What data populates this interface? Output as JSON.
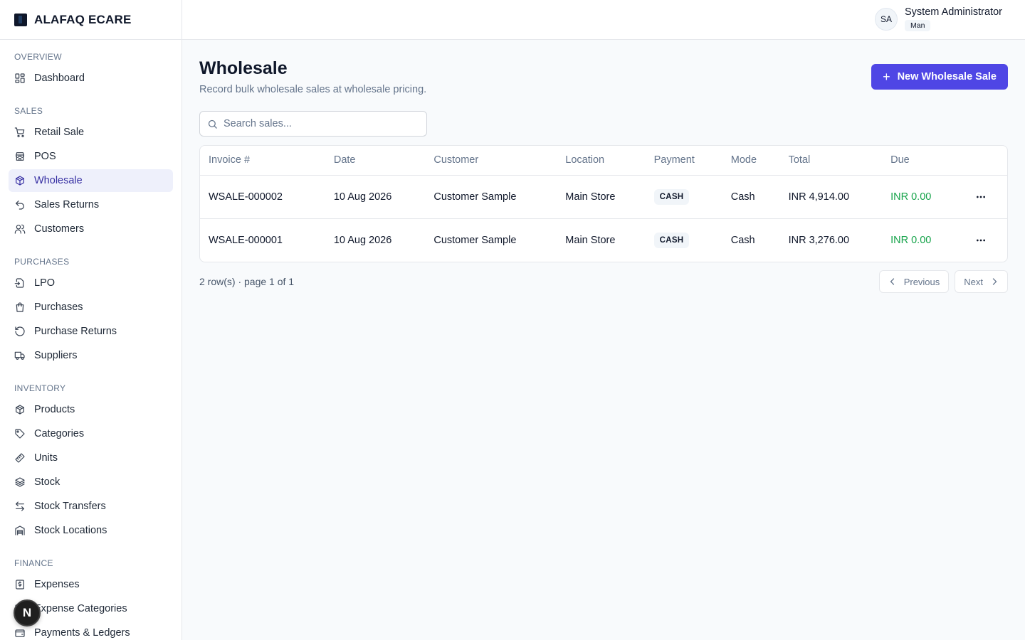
{
  "brand": {
    "name": "ALAFAQ ECARE"
  },
  "user": {
    "initials": "SA",
    "name": "System Administrator",
    "role": "Man"
  },
  "sidebar": {
    "sections": [
      {
        "title": "OVERVIEW",
        "items": [
          {
            "label": "Dashboard",
            "icon": "dashboard-icon"
          }
        ]
      },
      {
        "title": "SALES",
        "items": [
          {
            "label": "Retail Sale",
            "icon": "cart-icon"
          },
          {
            "label": "POS",
            "icon": "store-icon"
          },
          {
            "label": "Wholesale",
            "icon": "boxes-icon",
            "active": true
          },
          {
            "label": "Sales Returns",
            "icon": "undo-icon"
          },
          {
            "label": "Customers",
            "icon": "users-icon"
          }
        ]
      },
      {
        "title": "PURCHASES",
        "items": [
          {
            "label": "LPO",
            "icon": "file-import-icon"
          },
          {
            "label": "Purchases",
            "icon": "shopping-bag-icon"
          },
          {
            "label": "Purchase Returns",
            "icon": "rotate-icon"
          },
          {
            "label": "Suppliers",
            "icon": "truck-icon"
          }
        ]
      },
      {
        "title": "INVENTORY",
        "items": [
          {
            "label": "Products",
            "icon": "package-icon"
          },
          {
            "label": "Categories",
            "icon": "tag-icon"
          },
          {
            "label": "Units",
            "icon": "ruler-icon"
          },
          {
            "label": "Stock",
            "icon": "layers-icon"
          },
          {
            "label": "Stock Transfers",
            "icon": "arrows-transfer-icon"
          },
          {
            "label": "Stock Locations",
            "icon": "warehouse-icon"
          }
        ]
      },
      {
        "title": "FINANCE",
        "items": [
          {
            "label": "Expenses",
            "icon": "receipt-icon"
          },
          {
            "label": "Expense Categories",
            "icon": "list-icon"
          },
          {
            "label": "Payments & Ledgers",
            "icon": "wallet-icon"
          }
        ]
      }
    ]
  },
  "page": {
    "title": "Wholesale",
    "subtitle": "Record bulk wholesale sales at wholesale pricing.",
    "new_button": "New Wholesale Sale",
    "search_placeholder": "Search sales..."
  },
  "table": {
    "columns": [
      "Invoice #",
      "Date",
      "Customer",
      "Location",
      "Payment",
      "Mode",
      "Total",
      "Due"
    ],
    "rows": [
      {
        "invoice": "WSALE-000002",
        "date": "10 Aug 2026",
        "customer": "Customer Sample",
        "location": "Main Store",
        "payment": "CASH",
        "mode": "Cash",
        "total": "INR 4,914.00",
        "due": "INR 0.00"
      },
      {
        "invoice": "WSALE-000001",
        "date": "10 Aug 2026",
        "customer": "Customer Sample",
        "location": "Main Store",
        "payment": "CASH",
        "mode": "Cash",
        "total": "INR 3,276.00",
        "due": "INR 0.00"
      }
    ]
  },
  "pagination": {
    "info": "2 row(s) · page 1 of 1",
    "previous": "Previous",
    "next": "Next"
  },
  "floating_badge": {
    "letter": "N"
  },
  "colors": {
    "accent": "#4f46e5",
    "active_bg": "#eef0fb",
    "due_green": "#16a34a"
  }
}
